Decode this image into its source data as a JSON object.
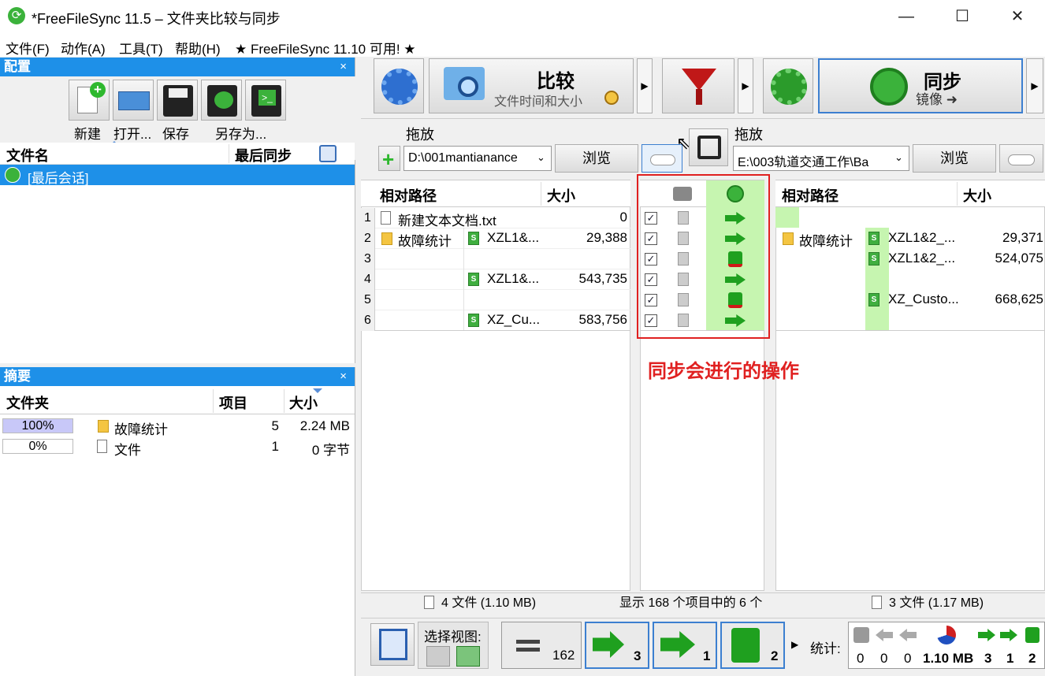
{
  "window": {
    "title": "*FreeFileSync 11.5 – 文件夹比较与同步",
    "minimize": "—",
    "maximize": "☐",
    "close": "✕"
  },
  "menu": [
    "文件(F)",
    "动作(A)",
    "工具(T)",
    "帮助(H)",
    "★ FreeFileSync 11.10 可用! ★"
  ],
  "config_panel": {
    "title": "配置",
    "close": "×",
    "buttons": [
      "新建",
      "打开...",
      "保存",
      "另存为..."
    ],
    "col_name": "文件名",
    "col_last_sync": "最后同步",
    "items": [
      "[最后会话]"
    ]
  },
  "summary_panel": {
    "title": "摘要",
    "close": "×",
    "headers": [
      "文件夹",
      "项目",
      "大小"
    ],
    "rows": [
      {
        "percent": "100%",
        "name": "故障统计",
        "count": "5",
        "size": "2.24 MB",
        "fill": 1.0
      },
      {
        "percent": "0%",
        "name": "文件",
        "count": "1",
        "size": "0 字节",
        "fill": 0.0
      }
    ]
  },
  "toolbar": {
    "compare_label": "比较",
    "compare_sub": "文件时间和大小",
    "sync_label": "同步",
    "sync_sub": "镜像 ➜"
  },
  "left": {
    "drop_label": "拖放",
    "path": "D:\\001mantianance",
    "browse": "浏览",
    "col_path": "相对路径",
    "col_size": "大小"
  },
  "right": {
    "drop_label": "拖放",
    "path": "E:\\003轨道交通工作\\Ba",
    "browse": "浏览",
    "col_path": "相对路径",
    "col_size": "大小"
  },
  "rows": [
    {
      "num": "1",
      "lfolder": "",
      "lname": "新建文本文档.txt",
      "lsize": "0",
      "rfolder": "",
      "rname": "",
      "rsize": ""
    },
    {
      "num": "2",
      "lfolder": "故障统计",
      "lname": "XZL1&...",
      "lsize": "29,388",
      "rfolder": "故障统计",
      "rname": "XZL1&2_...",
      "rsize": "29,371"
    },
    {
      "num": "3",
      "lfolder": "",
      "lname": "",
      "lsize": "",
      "rfolder": "",
      "rname": "XZL1&2_...",
      "rsize": "524,075"
    },
    {
      "num": "4",
      "lfolder": "",
      "lname": "XZL1&...",
      "lsize": "543,735",
      "rfolder": "",
      "rname": "",
      "rsize": ""
    },
    {
      "num": "5",
      "lfolder": "",
      "lname": "",
      "lsize": "",
      "rfolder": "",
      "rname": "XZ_Custo...",
      "rsize": "668,625"
    },
    {
      "num": "6",
      "lfolder": "",
      "lname": "XZ_Cu...",
      "lsize": "583,756",
      "rfolder": "",
      "rname": "",
      "rsize": ""
    }
  ],
  "annotation": "同步会进行的操作",
  "status": {
    "left": "4 文件 (1.10 MB)",
    "middle": "显示 168 个项目中的 6 个",
    "right": "3 文件 (1.17 MB)"
  },
  "bottom": {
    "select_view": "选择视图:",
    "equal_count": "162",
    "create_count": "3",
    "update_count": "1",
    "delete_count": "2",
    "stats_label": "统计:",
    "stats": [
      "0",
      "0",
      "0",
      "1.10 MB",
      "3",
      "1",
      "2"
    ]
  },
  "colors": {
    "accent": "#1e90e8",
    "annotation": "#e02020",
    "sync_green": "#c6f5b0"
  }
}
